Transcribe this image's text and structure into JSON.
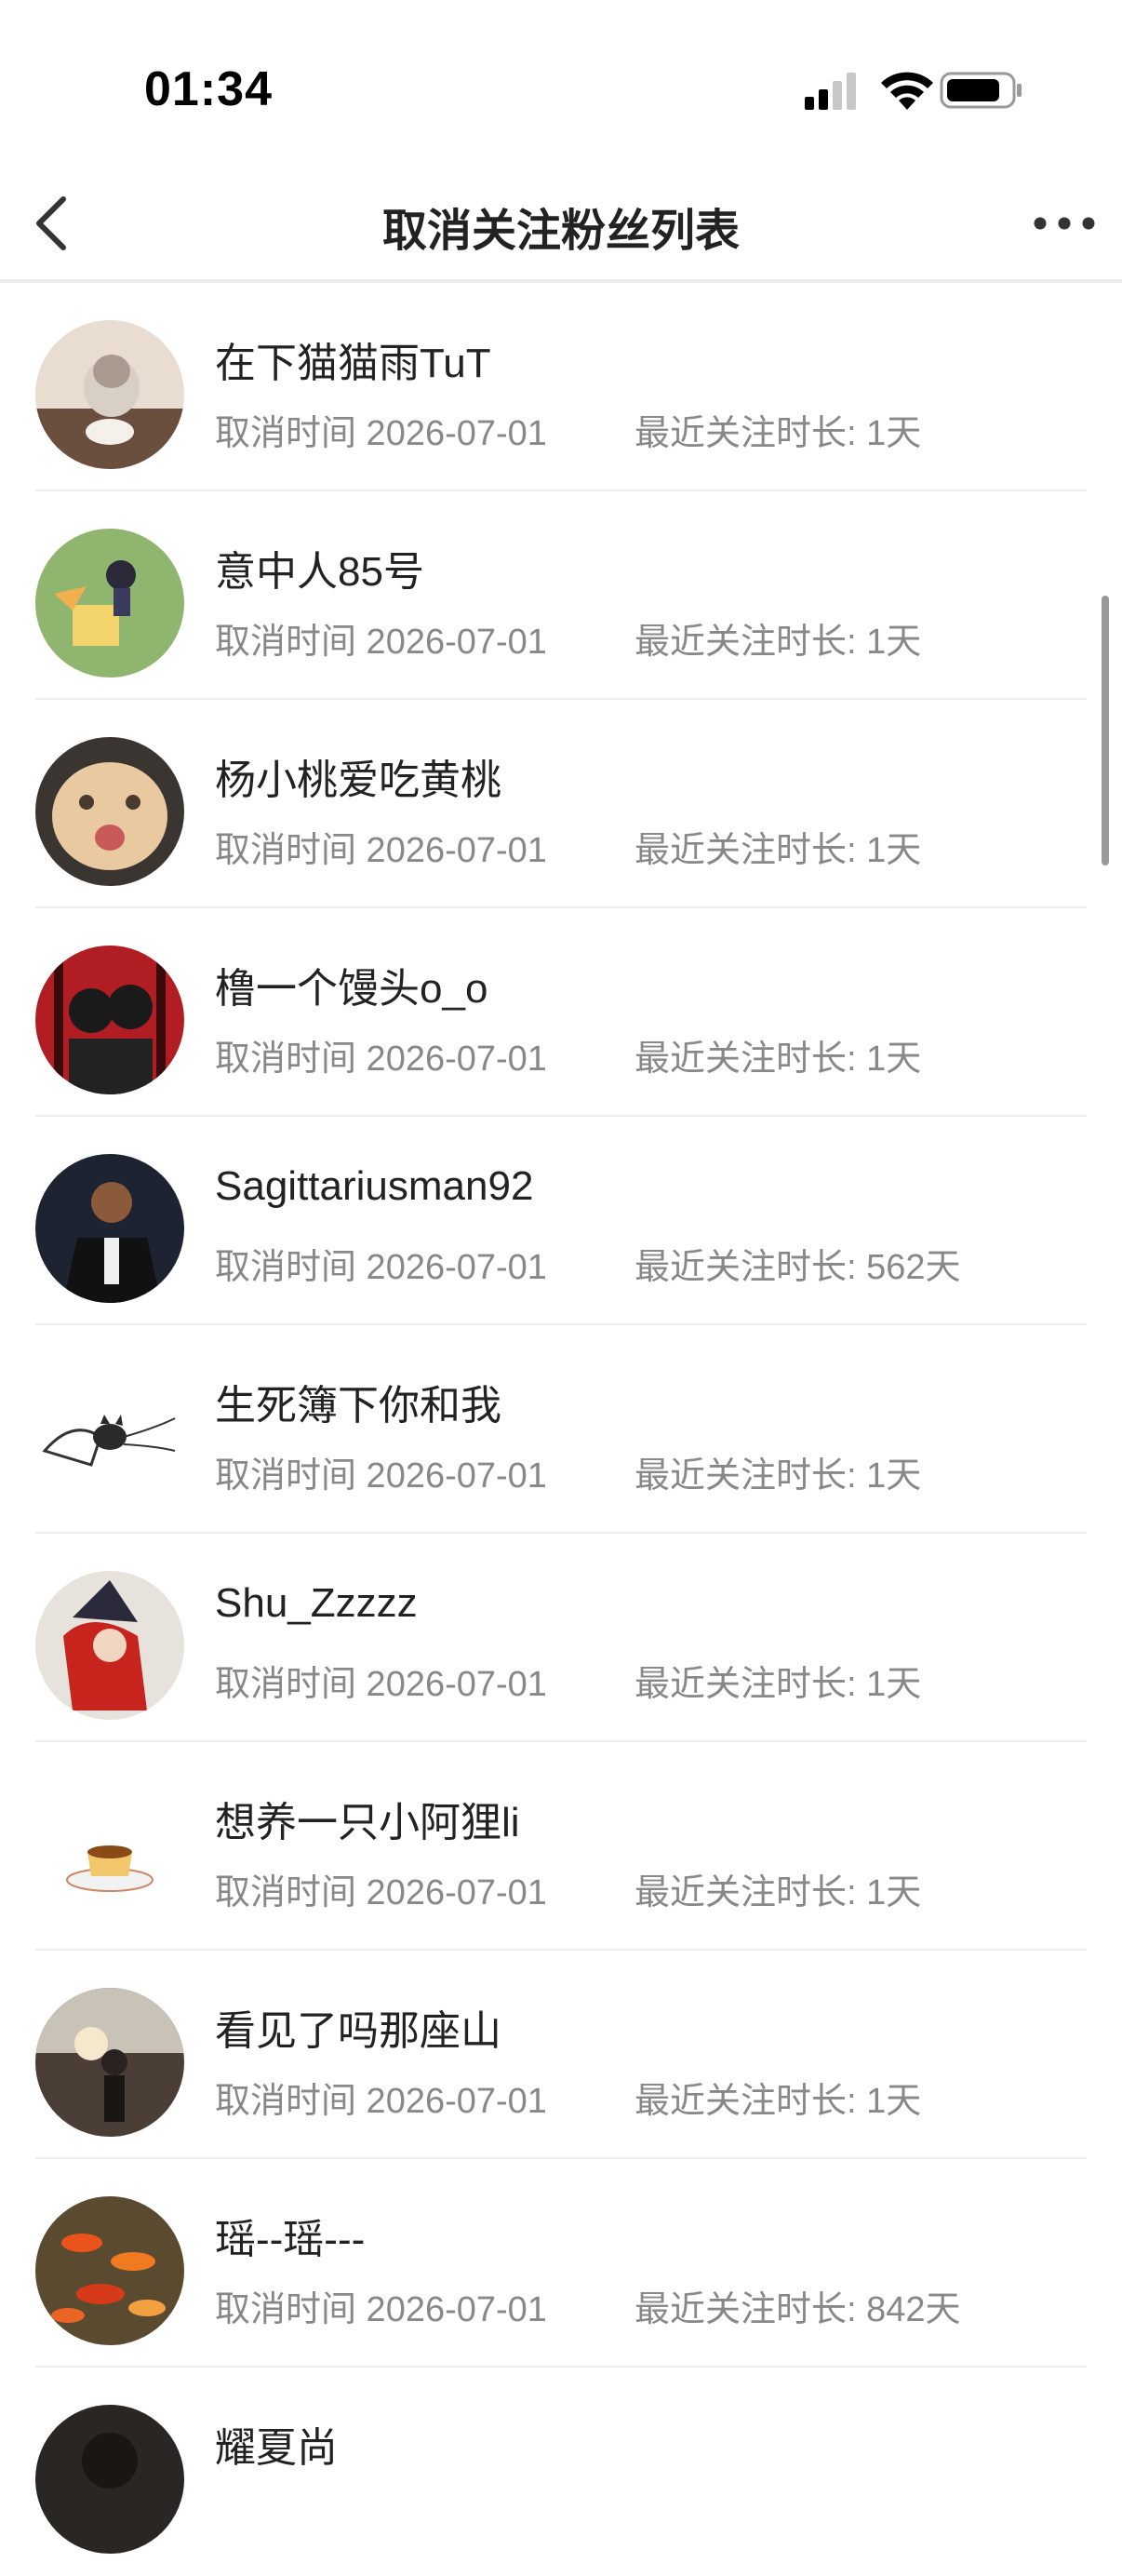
{
  "status_bar": {
    "time": "01:34",
    "signal_icon": "cellular-signal-icon",
    "wifi_icon": "wifi-icon",
    "battery_icon": "battery-icon"
  },
  "nav": {
    "title": "取消关注粉丝列表",
    "back_icon": "chevron-left-icon",
    "more_icon": "more-dots-icon"
  },
  "colors": {
    "text_primary": "#222222",
    "text_secondary": "#888888",
    "divider": "#ececec",
    "background": "#ffffff"
  },
  "fans": [
    {
      "name": "在下猫猫雨TuT",
      "cancel_time": "取消时间 2026-07-01",
      "duration": "最近关注时长: 1天"
    },
    {
      "name": "意中人85号",
      "cancel_time": "取消时间 2026-07-01",
      "duration": "最近关注时长: 1天"
    },
    {
      "name": "杨小桃爱吃黄桃",
      "cancel_time": "取消时间 2026-07-01",
      "duration": "最近关注时长: 1天"
    },
    {
      "name": "橹一个馒头o_o",
      "cancel_time": "取消时间 2026-07-01",
      "duration": "最近关注时长: 1天"
    },
    {
      "name": "Sagittariusman92",
      "cancel_time": "取消时间 2026-07-01",
      "duration": "最近关注时长: 562天"
    },
    {
      "name": "生死簿下你和我",
      "cancel_time": "取消时间 2026-07-01",
      "duration": "最近关注时长: 1天"
    },
    {
      "name": "Shu_Zzzzz",
      "cancel_time": "取消时间 2026-07-01",
      "duration": "最近关注时长: 1天"
    },
    {
      "name": "想养一只小阿狸li",
      "cancel_time": "取消时间 2026-07-01",
      "duration": "最近关注时长: 1天"
    },
    {
      "name": "看见了吗那座山",
      "cancel_time": "取消时间 2026-07-01",
      "duration": "最近关注时长: 1天"
    },
    {
      "name": "瑶--瑶---",
      "cancel_time": "取消时间 2026-07-01",
      "duration": "最近关注时长: 842天"
    },
    {
      "name": "耀夏尚",
      "cancel_time": "",
      "duration": ""
    }
  ]
}
